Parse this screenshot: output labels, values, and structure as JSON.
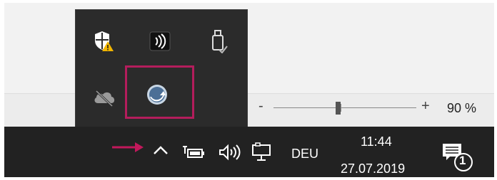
{
  "zoom": {
    "minus": "-",
    "plus": "+",
    "level": "90 %",
    "level_fraction": 0.47
  },
  "flyout": {
    "icons": [
      {
        "name": "windows-security-warning-icon"
      },
      {
        "name": "audio-connect-icon"
      },
      {
        "name": "usb-eject-icon"
      },
      {
        "name": "onedrive-offline-icon"
      },
      {
        "name": "app-refresh-icon",
        "highlighted": true
      }
    ]
  },
  "taskbar": {
    "show_hidden_icons": "^",
    "language": "DEU",
    "time": "11:44",
    "date": "27.07.2019",
    "notifications_count": "1",
    "icons": [
      "battery-icon",
      "volume-icon",
      "network-icon"
    ]
  },
  "colors": {
    "highlight": "#b41d5c",
    "taskbar": "#222222",
    "flyout": "#2b2b2b"
  }
}
